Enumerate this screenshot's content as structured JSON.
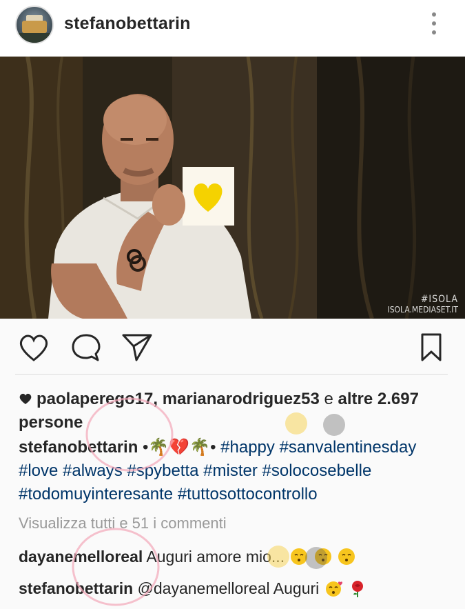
{
  "post": {
    "username": "stefanobettarin",
    "watermark_line1": "#ISOLA",
    "watermark_line2": "ISOLA.MEDIASET.IT"
  },
  "likes": {
    "users": "paolaperego17, marianarodriguez53",
    "connector": " e ",
    "others": "altre 2.697 persone"
  },
  "caption": {
    "username": "stefanobettarin",
    "emoji_text": "•🌴💔🌴•",
    "hashtags_line1": "#happy #sanvalentinesday",
    "hashtags_line2": "#love #always #spybetta #mister #solocosebelle",
    "hashtags_line3": "#todomuyinteresante #tuttosottocontrollo"
  },
  "view_all_comments": "Visualizza tutti e 51 i commenti",
  "comments": [
    {
      "username": "dayanemelloreal",
      "text": "Auguri amore mio..."
    },
    {
      "username": "stefanobettarin",
      "text": "@dayanemelloreal Auguri"
    }
  ],
  "colors": {
    "accent_hashtag": "#003569",
    "heart_yellow": "#f5d200",
    "icon_stroke": "#262626",
    "muted_text": "#999999"
  },
  "icons": {
    "like": "heart-outline-icon",
    "comment": "speech-bubble-icon",
    "share": "paper-plane-icon",
    "save": "bookmark-icon",
    "more": "three-dots-icon"
  }
}
